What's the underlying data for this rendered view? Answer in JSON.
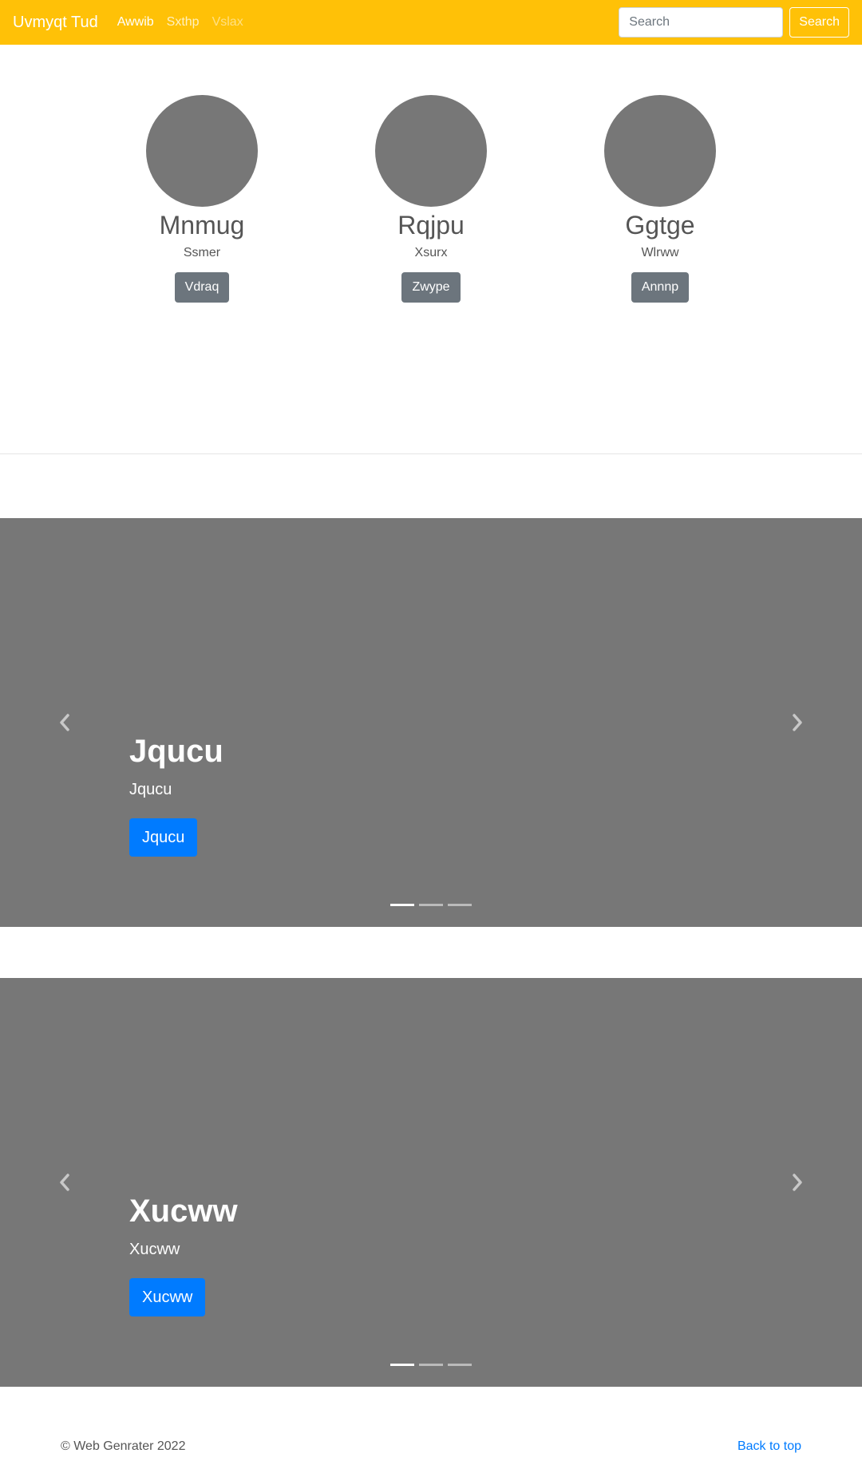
{
  "navbar": {
    "brand": "Uvmyqt Tud",
    "links": [
      "Awwib",
      "Sxthp",
      "Vslax"
    ],
    "search_placeholder": "Search",
    "search_button": "Search"
  },
  "people": [
    {
      "name": "Mnmug",
      "subtitle": "Ssmer",
      "button": "Vdraq"
    },
    {
      "name": "Rqjpu",
      "subtitle": "Xsurx",
      "button": "Zwype"
    },
    {
      "name": "Ggtge",
      "subtitle": "Wlrww",
      "button": "Annnp"
    }
  ],
  "carousels": [
    {
      "title": "Jqucu",
      "text": "Jqucu",
      "button": "Jqucu",
      "slides": 3,
      "active_slide": 1
    },
    {
      "title": "Xucww",
      "text": "Xucww",
      "button": "Xucww",
      "slides": 3,
      "active_slide": 1
    }
  ],
  "footer": {
    "copyright": "© Web Genrater 2022",
    "back_to_top": "Back to top"
  },
  "colors": {
    "navbar": "#ffc107",
    "placeholder": "#777777",
    "secondary_button": "#6c757d",
    "primary_button": "#007bff"
  }
}
